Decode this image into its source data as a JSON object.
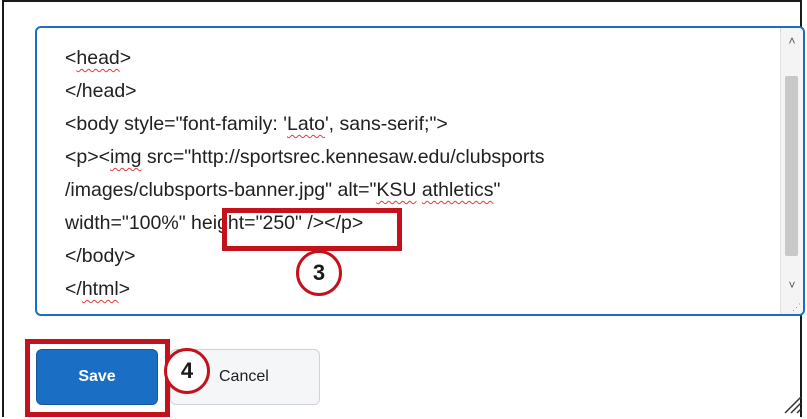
{
  "editor": {
    "lines": [
      "<head>",
      "</head>",
      "<body style=\"font-family: 'Lato', sans-serif;\">",
      "<p><img src=\"http://sportsrec.kennesaw.edu/clubsports",
      "/images/clubsports-banner.jpg\" alt=\"KSU athletics\"",
      "width=\"100%\" height=\"250\" /></p>",
      "</body>",
      "</html>"
    ],
    "line1_tag": "head",
    "line3_pre": "<body style=\"font-family: '",
    "line3_word": "Lato",
    "line3_post": "', sans-serif;\">",
    "line4_pre": "<p><",
    "line4_word": "img",
    "line4_post": " src=\"http://sportsrec.kennesaw.edu/clubsports",
    "line5_pre": "/images/clubsports-banner.jpg\" alt=\"",
    "line5_word1": "KSU",
    "line5_mid": " ",
    "line5_word2": "athletics",
    "line5_post": "\"",
    "line6_pre": "width=\"100%\" ",
    "line6_attr": "height=\"250\"",
    "line6_post": " /></p>",
    "line8_pre": "</",
    "line8_word": "html",
    "line8_post": ">"
  },
  "callouts": {
    "step3": "3",
    "step4": "4"
  },
  "buttons": {
    "save_label": "Save",
    "cancel_label": "Cancel"
  },
  "colors": {
    "accent_blue": "#1a6fc4",
    "callout_red": "#c4121c",
    "spell_underline": "#e23b3b"
  }
}
